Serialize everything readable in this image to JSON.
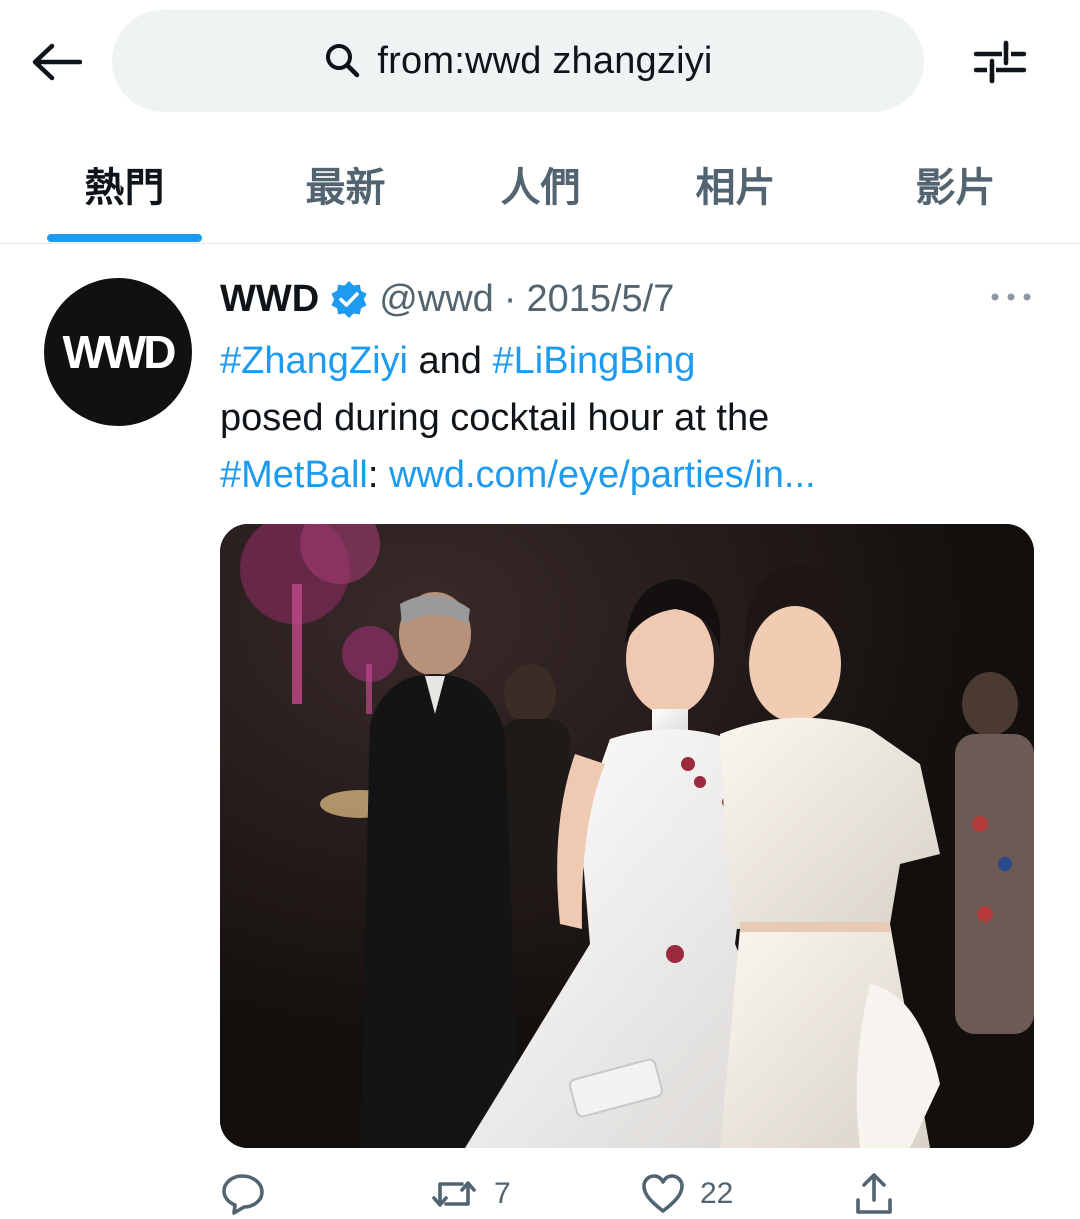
{
  "search": {
    "query": "from:wwd zhangziyi"
  },
  "tabs": [
    {
      "label": "熱門",
      "active": true
    },
    {
      "label": "最新",
      "active": false
    },
    {
      "label": "人們",
      "active": false
    },
    {
      "label": "相片",
      "active": false
    },
    {
      "label": "影片",
      "active": false
    }
  ],
  "tweet": {
    "avatar_text": "WWD",
    "display_name": "WWD",
    "verified": true,
    "handle": "@wwd",
    "separator": "·",
    "date": "2015/5/7",
    "text": {
      "tag1": "#ZhangZiyi",
      "and": " and ",
      "tag2": "#LiBingBing",
      "line2": "posed during cocktail hour at the",
      "tag3": "#MetBall",
      "colon": ": ",
      "link": "wwd.com/eye/parties/in..."
    },
    "metrics": {
      "retweets": "7",
      "likes": "22"
    }
  },
  "colors": {
    "accent": "#1d9bf0",
    "text_primary": "#0f1419",
    "text_secondary": "#536471",
    "search_bg": "#eff3f4"
  },
  "icons": [
    "back-arrow-icon",
    "search-icon",
    "filter-sliders-icon",
    "verified-badge-icon",
    "more-icon",
    "reply-icon",
    "retweet-icon",
    "like-icon",
    "share-icon"
  ]
}
